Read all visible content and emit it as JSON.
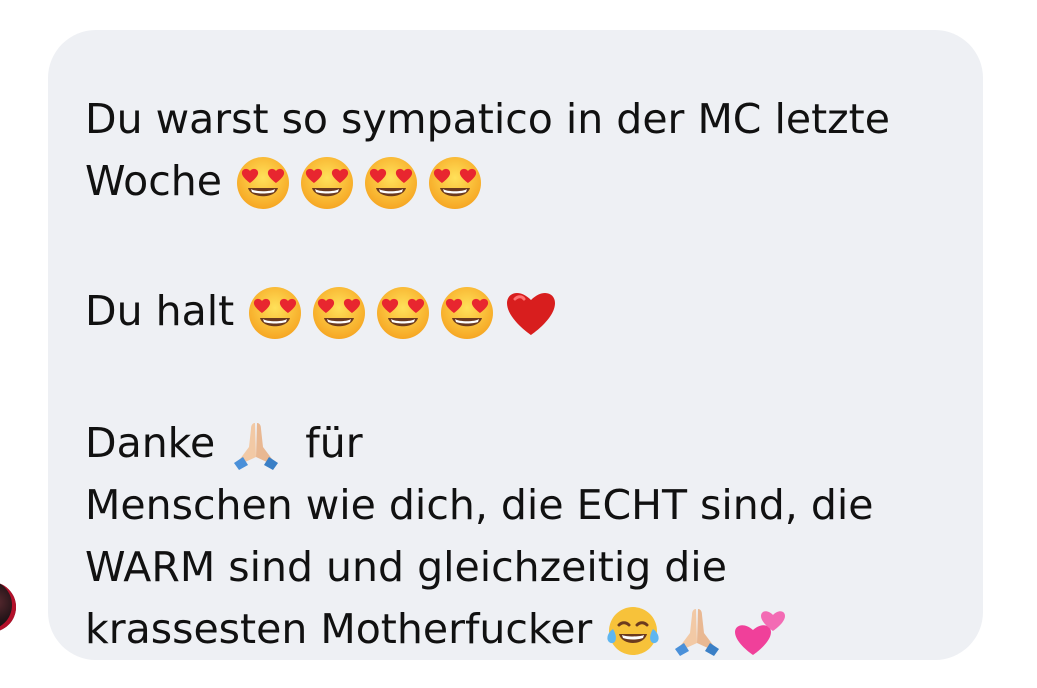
{
  "message": {
    "line1": "Du warst so sympatico in der MC letzte",
    "line2_text": "Woche",
    "line3_text": "Du halt",
    "line4_text_a": "Danke",
    "line4_text_b": "für",
    "line5": "Menschen wie dich, die ECHT sind, die",
    "line6": "WARM sind und gleichzeitig die",
    "line7_text": "krassesten Motherfucker"
  },
  "icons": {
    "heart_eyes": "heart-eyes-emoji",
    "red_heart": "red-heart-emoji",
    "folded_hands": "folded-hands-emoji",
    "tears_of_joy": "tears-of-joy-emoji",
    "two_hearts": "two-hearts-emoji"
  },
  "colors": {
    "bubble_bg": "#eef0f4",
    "text": "#111111"
  }
}
